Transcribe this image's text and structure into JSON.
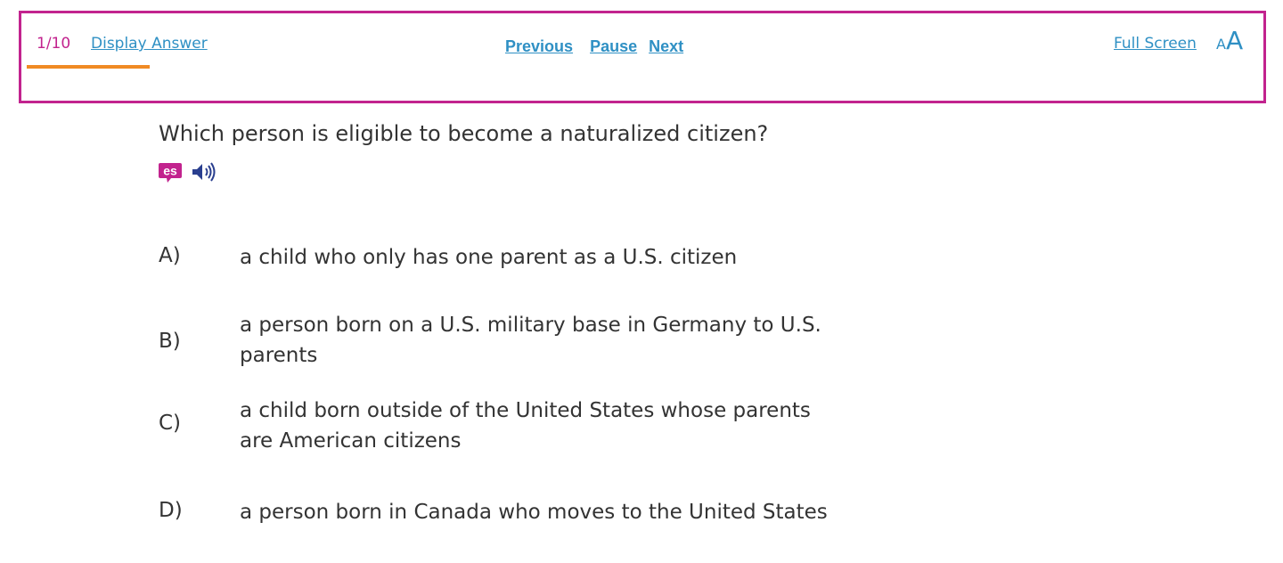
{
  "toolbar": {
    "counter": "1/10",
    "display_answer_label": "Display Answer",
    "previous_label": "Previous",
    "pause_label": "Pause",
    "next_label": "Next",
    "full_screen_label": "Full Screen",
    "font_size_small": "A",
    "font_size_large": "A",
    "progress": 0.1,
    "colors": {
      "border": "#c2238e",
      "counter": "#c2238e",
      "progress": "#f08a24",
      "link": "#2f90c4"
    }
  },
  "question": {
    "text": "Which person is eligible to become a naturalized citizen?",
    "spanish_icon": "spanish-translation-icon",
    "spanish_icon_text": "es",
    "audio_icon": "speaker-icon"
  },
  "answers": [
    {
      "letter": "A)",
      "text": "a child who only has one parent as a U.S. citizen"
    },
    {
      "letter": "B)",
      "text": "a person born on a U.S. military base in Germany to U.S. parents"
    },
    {
      "letter": "C)",
      "text": "a child born outside of the United States whose parents are American citizens"
    },
    {
      "letter": "D)",
      "text": "a person born in Canada who moves to the United States"
    }
  ]
}
